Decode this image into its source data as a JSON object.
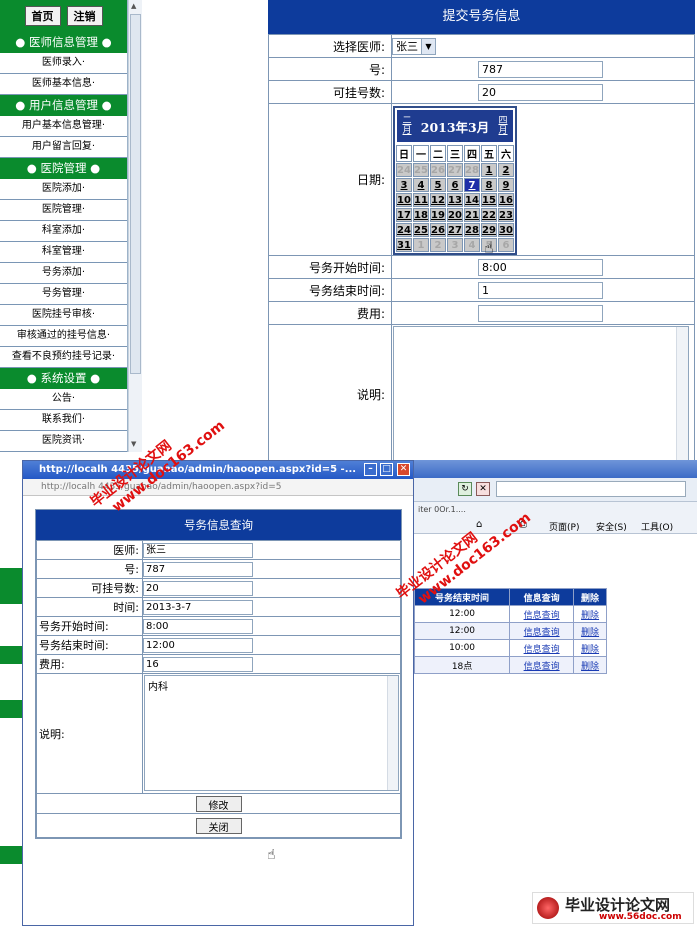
{
  "sidebar": {
    "home_btn": "首页",
    "logout_btn": "注销",
    "sections": [
      {
        "title": "● 医师信息管理 ●",
        "items": [
          "医师录入·",
          "医师基本信息·"
        ]
      },
      {
        "title": "● 用户信息管理 ●",
        "items": [
          "用户基本信息管理·",
          "用户留言回复·"
        ]
      },
      {
        "title": "● 医院管理 ●",
        "items": [
          "医院添加·",
          "医院管理·",
          "科室添加·",
          "科室管理·",
          "号务添加·",
          "号务管理·",
          "医院挂号审核·",
          "审核通过的挂号信息·",
          "查看不良预约挂号记录·"
        ]
      },
      {
        "title": "● 系统设置 ●",
        "items": [
          "公告·",
          "联系我们·",
          "医院资讯·"
        ]
      }
    ]
  },
  "form_submit": {
    "title": "提交号务信息",
    "doctor_label": "选择医师:",
    "doctor_value": "张三",
    "number_label": "号:",
    "number_value": "787",
    "count_label": "可挂号数:",
    "count_value": "20",
    "date_label": "日期:",
    "start_label": "号务开始时间:",
    "start_value": "8:00",
    "end_label": "号务结束时间:",
    "end_value": "1",
    "fee_label": "费用:",
    "fee_value": "",
    "desc_label": "说明:"
  },
  "calendar": {
    "prev": "二月",
    "next": "四月",
    "title": "2013年3月",
    "weekdays": [
      "日",
      "一",
      "二",
      "三",
      "四",
      "五",
      "六"
    ],
    "selected": "7",
    "weeks": [
      [
        "24",
        "25",
        "26",
        "27",
        "28",
        "1",
        "2"
      ],
      [
        "3",
        "4",
        "5",
        "6",
        "7",
        "8",
        "9"
      ],
      [
        "10",
        "11",
        "12",
        "13",
        "14",
        "15",
        "16"
      ],
      [
        "17",
        "18",
        "19",
        "20",
        "21",
        "22",
        "23"
      ],
      [
        "24",
        "25",
        "26",
        "27",
        "28",
        "29",
        "30"
      ],
      [
        "31",
        "1",
        "2",
        "3",
        "4",
        "5",
        "6"
      ]
    ]
  },
  "popup": {
    "title": "http://localh    4435/guahao/admin/haoopen.aspx?id=5 -...",
    "address": "http://localh    4435/guahao/admin/haoopen.aspx?id=5",
    "form_title": "号务信息查询",
    "rows": [
      {
        "label": "医师:",
        "value": "张三"
      },
      {
        "label": "号:",
        "value": "787"
      },
      {
        "label": "可挂号数:",
        "value": "20"
      },
      {
        "label": "时间:",
        "value": "2013-3-7"
      },
      {
        "label": "号务开始时间:",
        "value": "8:00"
      },
      {
        "label": "号务结束时间:",
        "value": "12:00"
      },
      {
        "label": "费用:",
        "value": "16"
      }
    ],
    "desc_label": "说明:",
    "desc_value": "内科",
    "modify_btn": "修改",
    "close_btn": "关闭"
  },
  "bg_browser": {
    "toolbar_page": "页面(P)",
    "toolbar_safety": "安全(S)",
    "toolbar_tools": "工具(O)",
    "tab_text": "iter 0Or.1....",
    "table_headers": [
      "号务结束时间",
      "信息查询",
      "删除"
    ],
    "table_rows": [
      [
        "12:00",
        "信息查询",
        "删除"
      ],
      [
        "12:00",
        "信息查询",
        "删除"
      ],
      [
        "10:00",
        "信息查询",
        "删除"
      ],
      [
        "18点",
        "信息查询",
        "删除"
      ]
    ]
  },
  "watermarks": {
    "text1": "毕业设计论文网",
    "text2": "www.doc163.com",
    "logo_text": "毕业设计论文网",
    "logo_url": "www.56doc.com"
  },
  "colors": {
    "green": "#0a8b2d",
    "blue": "#0d3b9c"
  }
}
